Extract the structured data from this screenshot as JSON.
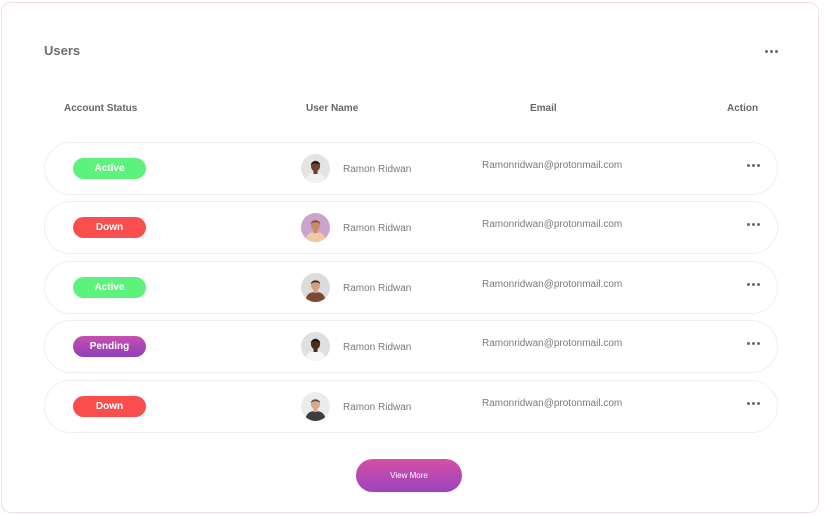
{
  "card": {
    "title": "Users",
    "menu_icon": "more-horizontal-icon"
  },
  "columns": {
    "status": "Account Status",
    "user": "User Name",
    "email": "Email",
    "action": "Action"
  },
  "status_colors": {
    "Active": "#5cf27c",
    "Down": "#f84e4e",
    "Pending": "#b14ab6"
  },
  "rows": [
    {
      "status": "Active",
      "name": "Ramon Ridwan",
      "email": "Ramonridwan@protonmail.com",
      "avatar_bg": "#e4e4e4",
      "skin": "#6b4330",
      "shirt": "#f1f1f1",
      "hair": "#1a120e"
    },
    {
      "status": "Down",
      "name": "Ramon Ridwan",
      "email": "Ramonridwan@protonmail.com",
      "avatar_bg": "#caa3cf",
      "skin": "#c88a65",
      "shirt": "#f4c7a3",
      "hair": "#7a4a2c"
    },
    {
      "status": "Active",
      "name": "Ramon Ridwan",
      "email": "Ramonridwan@protonmail.com",
      "avatar_bg": "#dcdcdc",
      "skin": "#d49f80",
      "shirt": "#7a4a36",
      "hair": "#3a2618"
    },
    {
      "status": "Pending",
      "name": "Ramon Ridwan",
      "email": "Ramonridwan@protonmail.com",
      "avatar_bg": "#e0e0e0",
      "skin": "#4a2e20",
      "shirt": "#f6f6f6",
      "hair": "#111111"
    },
    {
      "status": "Down",
      "name": "Ramon Ridwan",
      "email": "Ramonridwan@protonmail.com",
      "avatar_bg": "#ececec",
      "skin": "#d7a98a",
      "shirt": "#3e3e3e",
      "hair": "#5b4a3d"
    }
  ],
  "footer": {
    "view_more": "View More",
    "button_gradient": [
      "#d64fa3",
      "#9a44be"
    ]
  }
}
